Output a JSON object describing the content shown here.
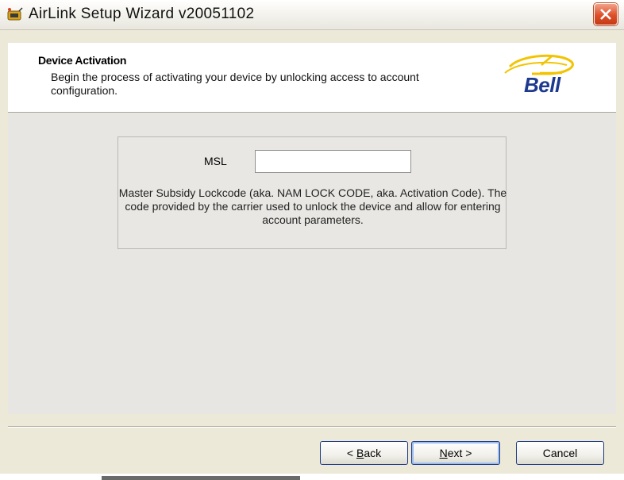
{
  "window": {
    "title": "AirLink Setup Wizard v20051102"
  },
  "header": {
    "title": "Device Activation",
    "description": "Begin the process of activating your device by unlocking access to account configuration.",
    "logo_text": "Bell"
  },
  "form": {
    "msl_label": "MSL",
    "msl_value": "",
    "msl_description": "Master Subsidy Lockcode (aka. NAM LOCK CODE, aka. Activation Code). The code provided by the carrier used to unlock the device and allow for entering account parameters."
  },
  "buttons": {
    "back_pre": "< ",
    "back_accel": "B",
    "back_rest": "ack",
    "next_accel": "N",
    "next_rest": "ext >",
    "cancel": "Cancel"
  },
  "icons": {
    "app": "airlink-app-icon",
    "close": "close-icon"
  },
  "colors": {
    "close_button": "#de4f27",
    "logo_blue": "#1d3a8f",
    "logo_yellow": "#f2c400"
  }
}
